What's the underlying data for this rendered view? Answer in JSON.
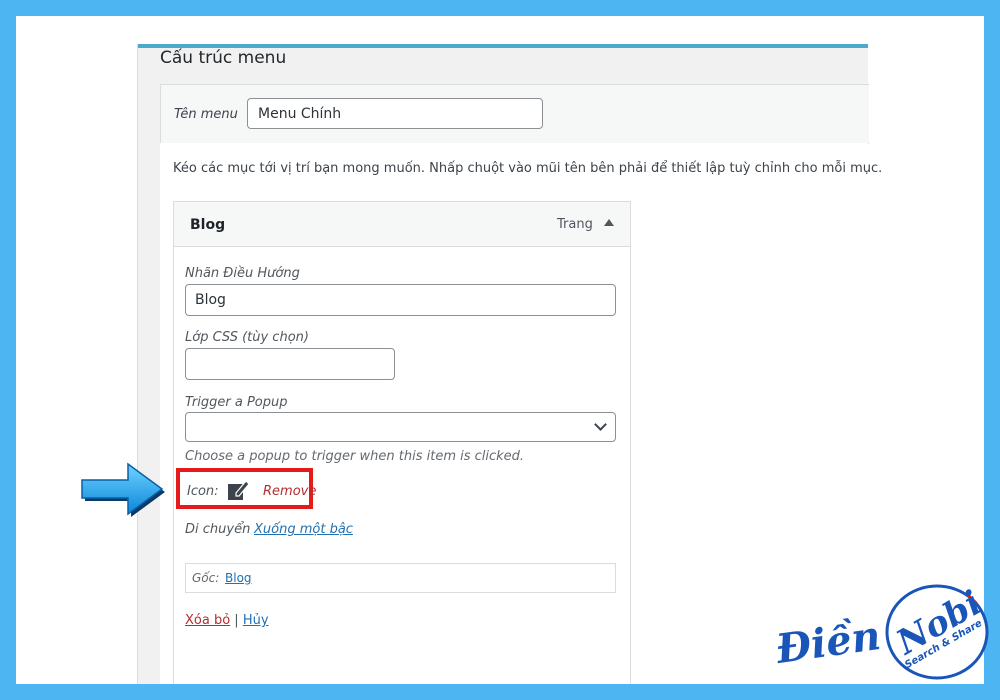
{
  "panel": {
    "title": "Cấu trúc menu",
    "menu_name_label": "Tên menu",
    "menu_name_value": "Menu Chính",
    "instructions": "Kéo các mục tới vị trí bạn mong muốn. Nhấp chuột vào mũi tên bên phải để thiết lập tuỳ chỉnh cho mỗi mục."
  },
  "menu_item": {
    "title": "Blog",
    "type": "Trang",
    "navigation_label": "Nhãn Điều Hướng",
    "navigation_value": "Blog",
    "css_label": "Lớp CSS (tùy chọn)",
    "css_value": "",
    "popup_label": "Trigger a Popup",
    "popup_selected": "",
    "popup_help": "Choose a popup to trigger when this item is clicked.",
    "icon_label": "Icon:",
    "icon_name": "edit-icon",
    "remove_label": "Remove",
    "move_label": "Di chuyển",
    "move_link": "Xuống một bậc",
    "original_label": "Gốc:",
    "original_link": "Blog",
    "delete_label": "Xóa bỏ",
    "separator": " | ",
    "cancel_label": "Hủy"
  },
  "watermark": {
    "name_part1": "Điền",
    "name_part2": "Nobi",
    "tagline": "Search & Share"
  },
  "colors": {
    "frame": "#4db6f2",
    "highlight_box": "#e51b1b",
    "link": "#2271b1",
    "destructive": "#b32d2e",
    "watermark": "#1a56b8"
  }
}
